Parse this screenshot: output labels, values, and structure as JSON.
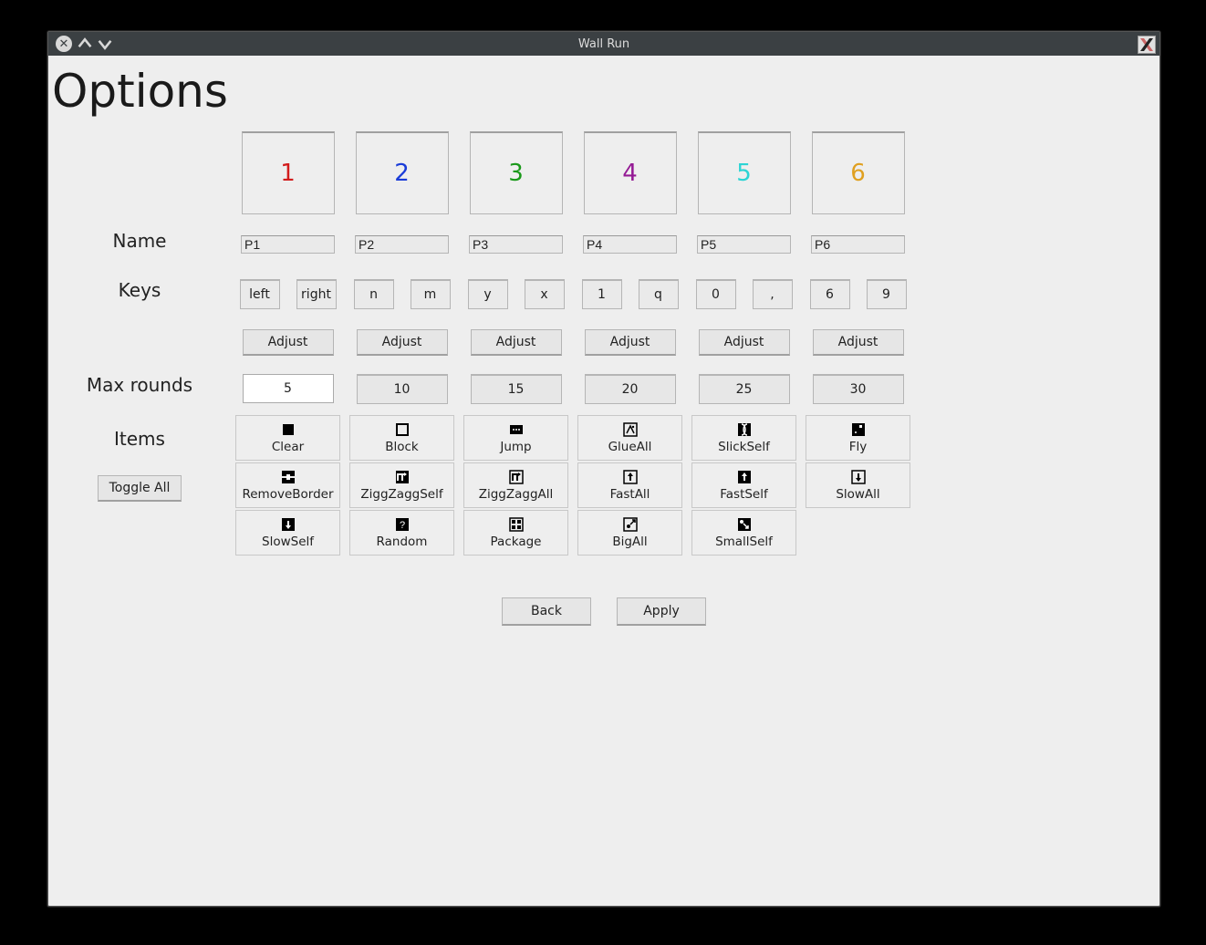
{
  "window": {
    "title": "Wall Run"
  },
  "page": {
    "title": "Options"
  },
  "labels": {
    "name": "Name",
    "keys": "Keys",
    "max_rounds": "Max rounds",
    "items": "Items",
    "toggle_all": "Toggle All",
    "adjust": "Adjust"
  },
  "players": [
    {
      "num": "1",
      "name": "P1",
      "key_left": "left",
      "key_right": "right"
    },
    {
      "num": "2",
      "name": "P2",
      "key_left": "n",
      "key_right": "m"
    },
    {
      "num": "3",
      "name": "P3",
      "key_left": "y",
      "key_right": "x"
    },
    {
      "num": "4",
      "name": "P4",
      "key_left": "1",
      "key_right": "q"
    },
    {
      "num": "5",
      "name": "P5",
      "key_left": "0",
      "key_right": ","
    },
    {
      "num": "6",
      "name": "P6",
      "key_left": "6",
      "key_right": "9"
    }
  ],
  "rounds": {
    "options": [
      "5",
      "10",
      "15",
      "20",
      "25",
      "30"
    ],
    "selected": "5"
  },
  "items": [
    "Clear",
    "Block",
    "Jump",
    "GlueAll",
    "SlickSelf",
    "Fly",
    "RemoveBorder",
    "ZiggZaggSelf",
    "ZiggZaggAll",
    "FastAll",
    "FastSelf",
    "SlowAll",
    "SlowSelf",
    "Random",
    "Package",
    "BigAll",
    "SmallSelf"
  ],
  "buttons": {
    "back": "Back",
    "apply": "Apply"
  },
  "colors": {
    "p1": "#d21c1c",
    "p2": "#1a3cd8",
    "p3": "#1a991a",
    "p4": "#941a94",
    "p5": "#2cd4d4",
    "p6": "#e0a020"
  }
}
